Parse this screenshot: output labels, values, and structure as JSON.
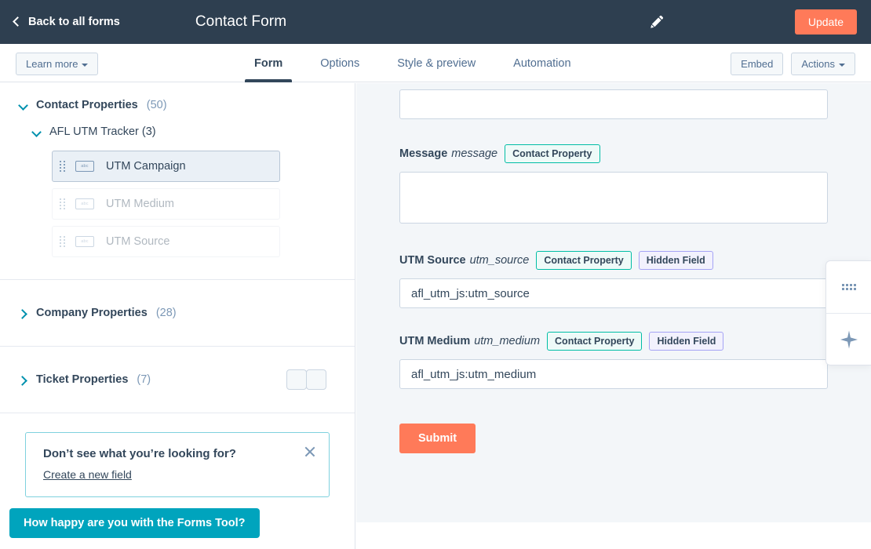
{
  "header": {
    "back_label": "Back to all forms",
    "title": "Contact Form",
    "edit_icon": "pencil-icon",
    "update_label": "Update",
    "bg_color": "#2e3f50",
    "accent_color": "#ff7a59"
  },
  "navbar": {
    "learn_more_label": "Learn more",
    "tabs": [
      {
        "label": "Form",
        "active": true
      },
      {
        "label": "Options",
        "active": false
      },
      {
        "label": "Style & preview",
        "active": false
      },
      {
        "label": "Automation",
        "active": false
      }
    ],
    "embed_label": "Embed",
    "actions_label": "Actions"
  },
  "sidebar": {
    "groups": [
      {
        "title": "Contact Properties",
        "count": "(50)",
        "expanded": true,
        "subgroup": {
          "title": "AFL UTM Tracker (3)",
          "expanded": true,
          "fields": [
            {
              "label": "UTM Campaign",
              "icon": "text-field-icon",
              "state": "selected"
            },
            {
              "label": "UTM Medium",
              "icon": "text-field-icon",
              "state": "dimmed"
            },
            {
              "label": "UTM Source",
              "icon": "text-field-icon",
              "state": "dimmed"
            }
          ]
        }
      },
      {
        "title": "Company Properties",
        "count": "(28)",
        "expanded": false
      },
      {
        "title": "Ticket Properties",
        "count": "(7)",
        "expanded": false
      }
    ],
    "callout": {
      "heading": "Don’t see what you’re looking for?",
      "link_label": "Create a new field",
      "close_icon": "close-icon",
      "border_color": "#7fd1de"
    },
    "feedback_label": "How happy are you with the Forms Tool?",
    "feedback_color": "#00a4bd"
  },
  "canvas": {
    "fields": [
      {
        "id": "top-partial",
        "label": "",
        "internal_name": "",
        "badges": [],
        "control": "input",
        "value": "",
        "partial": true
      },
      {
        "id": "message",
        "label": "Message",
        "internal_name": "message",
        "badges": [
          "Contact Property"
        ],
        "control": "textarea",
        "value": ""
      },
      {
        "id": "utm-source",
        "label": "UTM Source",
        "internal_name": "utm_source",
        "badges": [
          "Contact Property",
          "Hidden Field"
        ],
        "control": "input",
        "value": "afl_utm_js:utm_source"
      },
      {
        "id": "utm-medium",
        "label": "UTM Medium",
        "internal_name": "utm_medium",
        "badges": [
          "Contact Property",
          "Hidden Field"
        ],
        "control": "input",
        "value": "afl_utm_js:utm_medium"
      }
    ],
    "submit_label": "Submit",
    "badge_colors": {
      "contact_property": "#00bda5",
      "hidden_field": "#a5a3f5"
    },
    "background": "#f3f6f9"
  },
  "float_panel": {
    "items": [
      {
        "icon": "grid-dots-icon"
      },
      {
        "icon": "sparkle-ai-icon"
      }
    ]
  }
}
